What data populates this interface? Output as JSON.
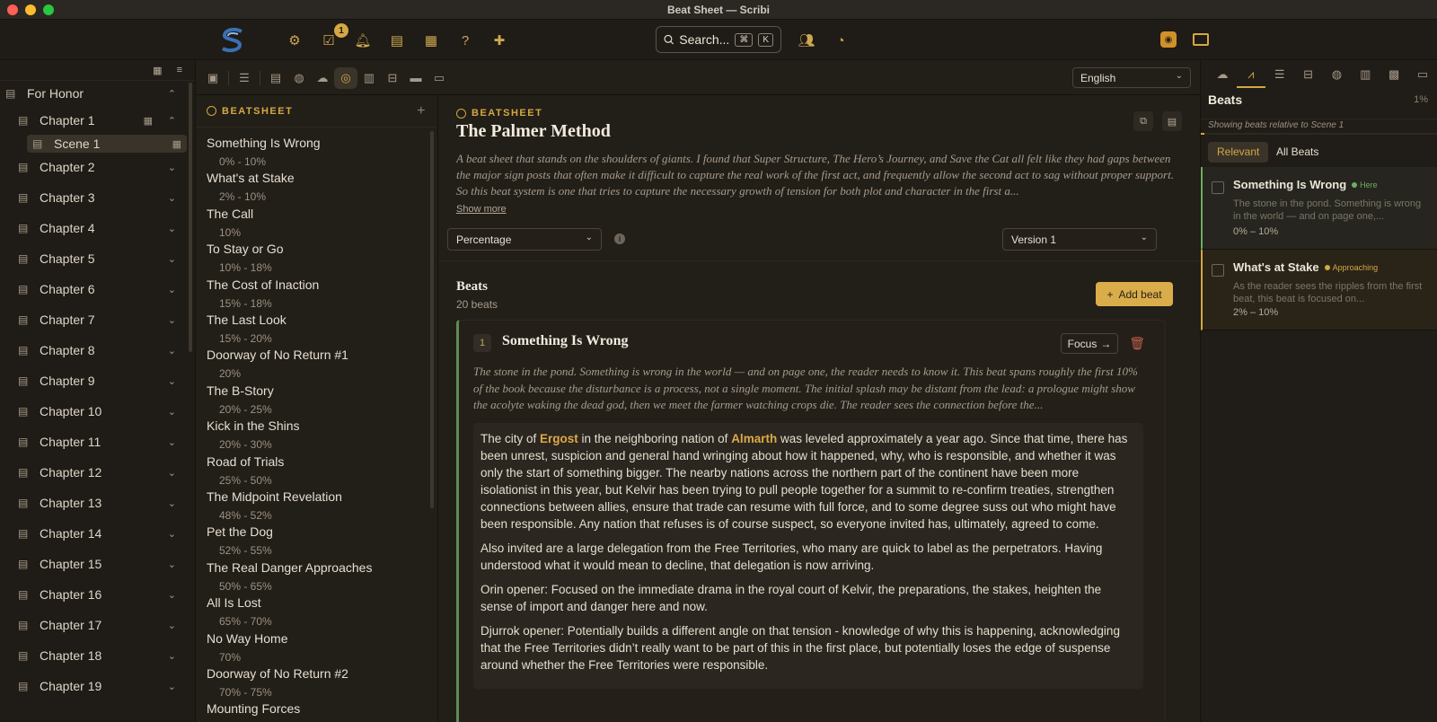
{
  "window": {
    "title": "Beat Sheet — Scribi"
  },
  "topbar": {
    "notification_count": "1",
    "search_label": "Search...",
    "search_key1": "⌘",
    "search_key2": "K",
    "icons": [
      "settings-icon",
      "tasks-icon",
      "bell-icon",
      "contacts-icon",
      "calendar-icon",
      "help-icon",
      "chat-icon"
    ]
  },
  "sidebar": {
    "project": "For Honor",
    "scene": "Scene 1",
    "chapters": [
      "Chapter 1",
      "Chapter 2",
      "Chapter 3",
      "Chapter 4",
      "Chapter 5",
      "Chapter 6",
      "Chapter 7",
      "Chapter 8",
      "Chapter 9",
      "Chapter 10",
      "Chapter 11",
      "Chapter 12",
      "Chapter 13",
      "Chapter 14",
      "Chapter 15",
      "Chapter 16",
      "Chapter 17",
      "Chapter 18",
      "Chapter 19"
    ]
  },
  "toolbar2": {
    "language": "English"
  },
  "beatlist": {
    "header": "BEATSHEET",
    "items": [
      {
        "title": "Something Is Wrong",
        "range": "0% - 10%"
      },
      {
        "title": "What's at Stake",
        "range": "2% - 10%"
      },
      {
        "title": "The Call",
        "range": "10%"
      },
      {
        "title": "To Stay or Go",
        "range": "10% - 18%"
      },
      {
        "title": "The Cost of Inaction",
        "range": "15% - 18%"
      },
      {
        "title": "The Last Look",
        "range": "15% - 20%"
      },
      {
        "title": "Doorway of No Return #1",
        "range": "20%"
      },
      {
        "title": "The B-Story",
        "range": "20% - 25%"
      },
      {
        "title": "Kick in the Shins",
        "range": "20% - 30%"
      },
      {
        "title": "Road of Trials",
        "range": "25% - 50%"
      },
      {
        "title": "The Midpoint Revelation",
        "range": "48% - 52%"
      },
      {
        "title": "Pet the Dog",
        "range": "52% - 55%"
      },
      {
        "title": "The Real Danger Approaches",
        "range": "50% - 65%"
      },
      {
        "title": "All Is Lost",
        "range": "65% - 70%"
      },
      {
        "title": "No Way Home",
        "range": "70%"
      },
      {
        "title": "Doorway of No Return #2",
        "range": "70% - 75%"
      },
      {
        "title": "Mounting Forces",
        "range": ""
      }
    ]
  },
  "main": {
    "tag": "BEATSHEET",
    "title": "The Palmer Method",
    "description": "A beat sheet that stands on the shoulders of giants. I found that Super Structure, The Hero’s Journey, and Save the Cat all felt like they had gaps between the major sign posts that often make it difficult to capture the real work of the first act, and frequently allow the second act to sag without proper support. So this beat system is one that tries to capture the necessary growth of tension for both plot and character in the first a...",
    "show_more": "Show more",
    "mode_select": "Percentage",
    "version_select": "Version 1",
    "beats_heading": "Beats",
    "beats_count": "20 beats",
    "add_beat": "Add beat",
    "card": {
      "number": "1",
      "title": "Something Is Wrong",
      "focus": "Focus",
      "description": "The stone in the pond. Something is wrong in the world — and on page one, the reader needs to know it. This beat spans roughly the first 10% of the book because the disturbance is a process, not a single moment. The initial splash may be distant from the lead: a prologue might show the acolyte waking the dead god, then we meet the farmer watching crops die. The reader sees the connection before the...",
      "p1_a": "The city of ",
      "p1_h1": "Ergost",
      "p1_b": " in the neighboring nation of ",
      "p1_h2": "Almarth",
      "p1_c": " was leveled approximately a year ago. Since that time, there has been unrest, suspicion and general hand wringing about how it happened, why, who is responsible, and whether it was only the start of something bigger. The nearby nations across the northern part of the continent have been more isolationist in this year, but Kelvir has been trying to pull people together for a summit to re-confirm treaties, strengthen connections between allies, ensure that trade can resume with full force, and to some degree suss out who might have been responsible. Any nation that refuses is of course suspect, so everyone invited has, ultimately, agreed to come.",
      "p2": "Also invited are a large delegation from the Free Territories, who many are quick to label as the perpetrators. Having understood what it would mean to decline, that delegation is now arriving.",
      "p3": "Orin opener: Focused on the immediate drama in the royal court of Kelvir, the preparations, the stakes, heighten the sense of import and danger here and now.",
      "p4": "Djurrok opener: Potentially builds a different angle on that tension - knowledge of why this is happening, acknowledging that the Free Territories didn’t really want to be part of this in the first place, but potentially loses the edge of suspense around whether the Free Territories were responsible."
    }
  },
  "rpanel": {
    "title": "Beats",
    "percent": "1%",
    "progress": 0.01,
    "subtitle": "Showing beats relative to Scene 1",
    "tab_relevant": "Relevant",
    "tab_all": "All Beats",
    "beats": [
      {
        "title": "Something Is Wrong",
        "tag": "Here",
        "tag_color": "#6fae5f",
        "desc": "The stone in the pond. Something is wrong in the world — and on page one,...",
        "range": "0% – 10%"
      },
      {
        "title": "What's at Stake",
        "tag": "Approaching",
        "tag_color": "#d4a843",
        "desc": "As the reader sees the ripples from the first beat, this beat is focused on...",
        "range": "2% – 10%"
      }
    ]
  },
  "colors": {
    "accent": "#d4a843",
    "here": "#6fae5f",
    "approaching": "#d4a843",
    "danger": "#c0604c"
  }
}
